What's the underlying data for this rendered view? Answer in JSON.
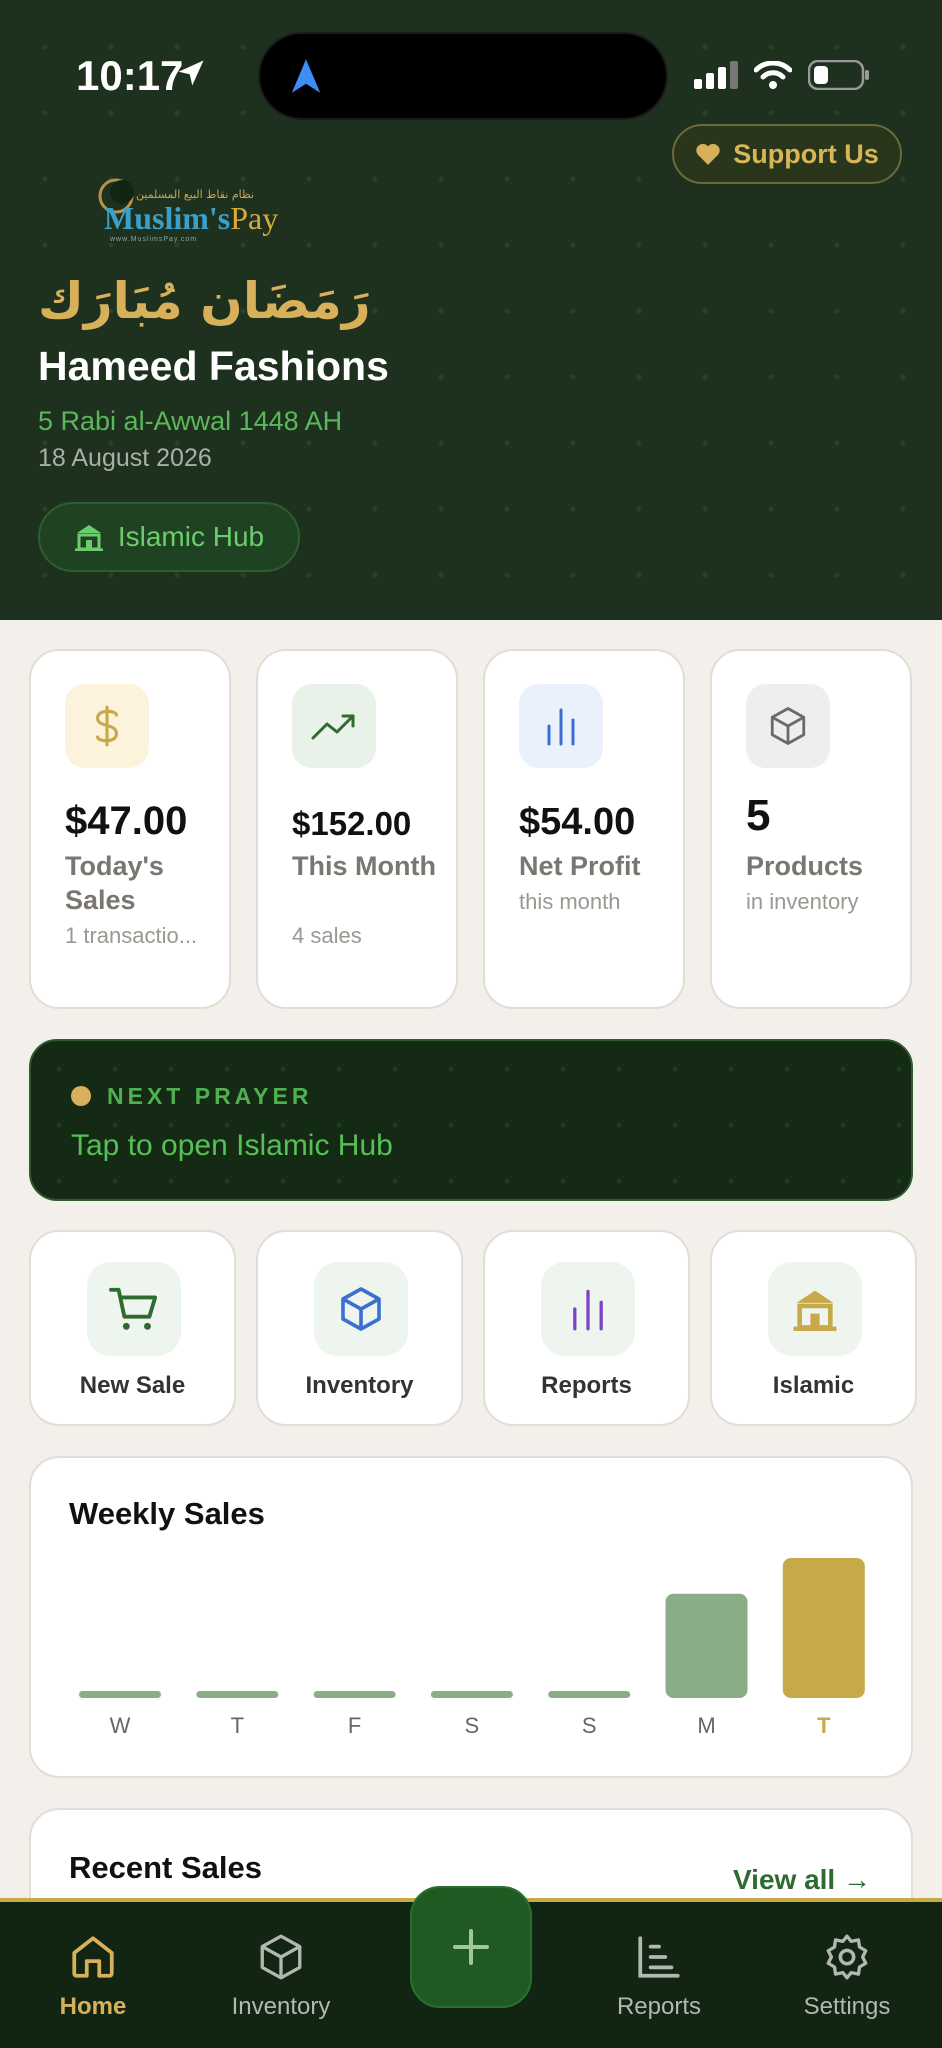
{
  "status_bar": {
    "time": "10:17"
  },
  "header": {
    "support_label": "Support Us",
    "logo": {
      "arabic": "نظام نقاط البيع المسلمين",
      "name_a": "Muslim's",
      "name_b": "Pay",
      "url": "www.MuslimsPay.com"
    },
    "greeting_arabic": "رَمَضَان مُبَارَك",
    "shop_name": "Hameed Fashions",
    "hijri_date": "5 Rabi al-Awwal 1448 AH",
    "gregorian_date": "18 August 2026",
    "hub_button": "Islamic Hub"
  },
  "stats": [
    {
      "icon": "dollar-icon",
      "value": "$47.00",
      "label": "Today's Sales",
      "sub": "1 transactio...",
      "icon_bg": "#fdf3dc",
      "icon_color": "#c8a94a"
    },
    {
      "icon": "trend-up-icon",
      "value": "$152.00",
      "label": "This Month",
      "sub": "4 sales",
      "icon_bg": "#e9f2e9",
      "icon_color": "#2e6b2e"
    },
    {
      "icon": "bar-chart-icon",
      "value": "$54.00",
      "label": "Net Profit",
      "sub": "this month",
      "icon_bg": "#eaf1fc",
      "icon_color": "#3b6fd0"
    },
    {
      "icon": "box-icon",
      "value": "5",
      "label": "Products",
      "sub": "in inventory",
      "icon_bg": "#eeeeee",
      "icon_color": "#6a6a6a"
    }
  ],
  "prayer": {
    "label": "NEXT PRAYER",
    "subtitle": "Tap to open Islamic Hub"
  },
  "actions": [
    {
      "label": "New Sale",
      "icon": "cart-icon"
    },
    {
      "label": "Inventory",
      "icon": "box-icon"
    },
    {
      "label": "Reports",
      "icon": "bars-icon"
    },
    {
      "label": "Islamic",
      "icon": "mosque-icon"
    }
  ],
  "weekly": {
    "title": "Weekly Sales"
  },
  "chart_data": {
    "type": "bar",
    "categories": [
      "W",
      "T",
      "F",
      "S",
      "S",
      "M",
      "T"
    ],
    "values": [
      0,
      0,
      0,
      0,
      0,
      35,
      47
    ],
    "highlight_index": 6,
    "colors": {
      "normal": "#8aad88",
      "highlight": "#c8a94a"
    }
  },
  "recent": {
    "title": "Recent Sales",
    "view_all": "View all →"
  },
  "nav": {
    "items": [
      {
        "label": "Home",
        "icon": "home-icon",
        "active": true
      },
      {
        "label": "Inventory",
        "icon": "box-icon",
        "active": false
      },
      {
        "label": "Reports",
        "icon": "chart-icon",
        "active": false
      },
      {
        "label": "Settings",
        "icon": "gear-icon",
        "active": false
      }
    ],
    "fab_icon": "plus-icon"
  },
  "colors": {
    "hero_bg": "#122512",
    "gold": "#d8b05a",
    "green_accent": "#5ab85a",
    "page_bg": "#f3f0ec"
  }
}
